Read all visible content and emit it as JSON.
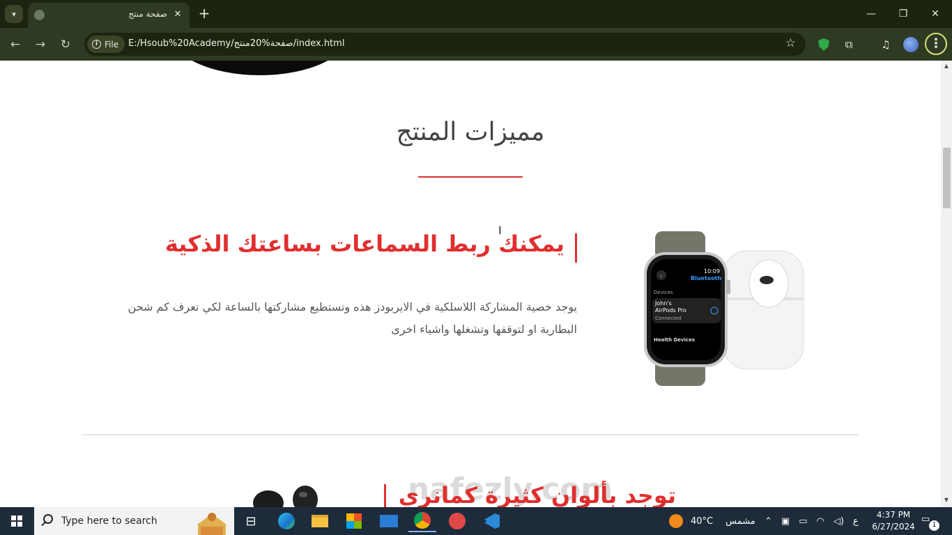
{
  "browser": {
    "tab_title": "صفحة منتج",
    "file_label": "File",
    "url": "E:/Hsoub%20Academy/صفحة%20منتج/index.html"
  },
  "page": {
    "section_title": "مميزات المنتج",
    "feature1_heading": "يمكنك ربط السماعات بساعتك الذكية",
    "feature1_text": "يوجد خصية المشاركة اللاسلكية في الايربودز هذه وتستطيع مشاركتها بالساعة لكي تعرف كم شحن البطارية او لتوقفها وتشغلها واشياء اخرى",
    "feature2_heading": "توجد بألوان كثيرة كمانري",
    "watermark": "nafezly.com",
    "watch_screen": {
      "time": "10:09",
      "title": "Bluetooth",
      "section": "Devices",
      "device_name": "John's AirPods Pro",
      "device_status": "Connected",
      "section2": "Health Devices"
    }
  },
  "taskbar": {
    "search_placeholder": "Type here to search",
    "weather_temp": "40°C",
    "weather_desc": "مشمس",
    "lang": "ع",
    "time": "4:37 PM",
    "date": "6/27/2024",
    "notification_count": "1"
  },
  "icons": {
    "tab_favicon": "globe-icon",
    "new_tab": "plus-icon",
    "back": "arrow-left-icon",
    "forward": "arrow-right-icon",
    "reload": "reload-icon",
    "bookmark": "star-icon",
    "extension_shield": "shield-icon",
    "extensions": "puzzle-icon",
    "media": "media-icon",
    "profile": "avatar"
  }
}
